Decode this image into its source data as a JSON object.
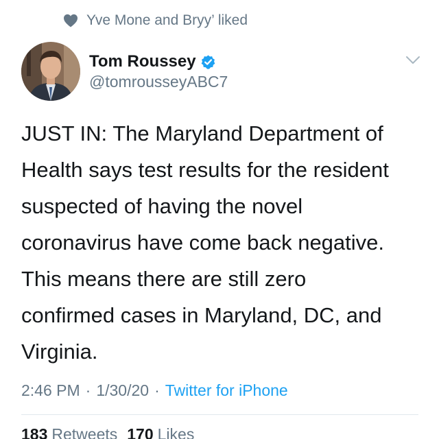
{
  "social_context": {
    "icon": "heart-icon",
    "text": "Yve Mone and Bryy’ liked"
  },
  "author": {
    "display_name": "Tom Roussey",
    "handle": "@tomrousseyABC7",
    "verified": true
  },
  "tweet": {
    "lines": [
      "JUST IN: The Maryland Department of",
      "Health says test results for the resident",
      "suspected of having the novel",
      "coronavirus have come back negative.",
      "This means there are still zero",
      "confirmed cases in Maryland, DC, and",
      "Virginia."
    ]
  },
  "meta": {
    "time": "2:46 PM",
    "separator": "·",
    "date": "1/30/20",
    "source": "Twitter for iPhone"
  },
  "stats": {
    "retweets_count": "183",
    "retweets_label": "Retweets",
    "likes_count": "170",
    "likes_label": "Likes"
  },
  "colors": {
    "accent": "#1da1f2",
    "secondary_text": "#657786",
    "primary_text": "#14171a",
    "divider": "#e1e8ed"
  }
}
